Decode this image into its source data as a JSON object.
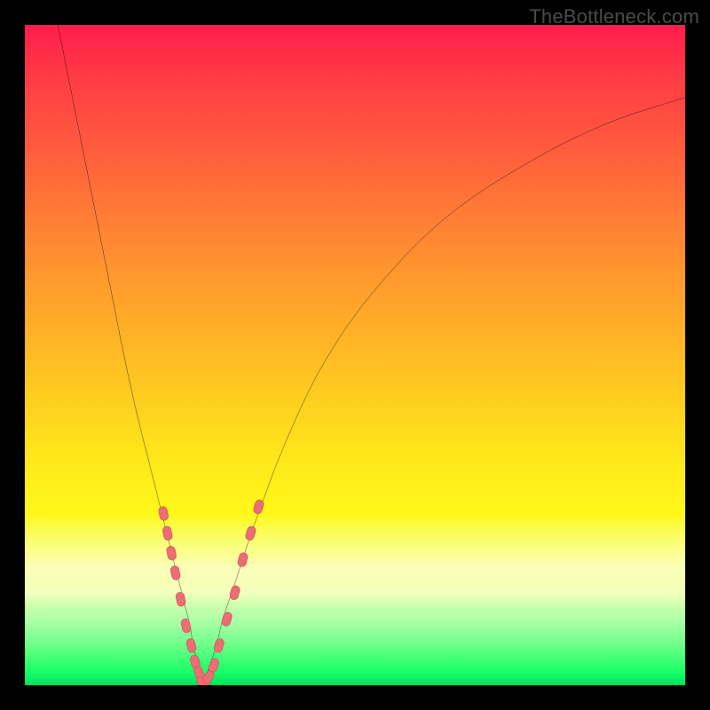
{
  "watermark": "TheBottleneck.com",
  "colors": {
    "frame": "#000000",
    "curve_stroke": "#000000",
    "marker_fill": "#eb6e73",
    "marker_stroke": "#d85c62",
    "gradient_top": "#ff1e4b",
    "gradient_bottom": "#00e060"
  },
  "chart_data": {
    "type": "line",
    "title": "",
    "xlabel": "",
    "ylabel": "",
    "xlim": [
      0,
      100
    ],
    "ylim": [
      0,
      100
    ],
    "note": "Bottleneck-style V curve. y = mismatch (0 at valley). x = relative capability. Values estimated from pixel positions; no axis ticks in source image.",
    "series": [
      {
        "name": "left-branch",
        "x": [
          5,
          7,
          9,
          11,
          13,
          15,
          17,
          19,
          21,
          22,
          23,
          24,
          25,
          25.5,
          26,
          26.5,
          27
        ],
        "y": [
          100,
          90,
          80,
          70,
          60,
          50,
          41,
          33,
          25,
          21,
          17,
          13,
          9,
          6,
          4,
          2,
          0
        ]
      },
      {
        "name": "right-branch",
        "x": [
          27,
          28,
          29,
          30,
          32,
          35,
          40,
          46,
          54,
          64,
          76,
          88,
          100
        ],
        "y": [
          0,
          3,
          6,
          10,
          16,
          25,
          38,
          50,
          61,
          71,
          79,
          85,
          89
        ]
      }
    ],
    "markers": {
      "name": "highlighted-points",
      "style": "pill",
      "points_xy": [
        [
          21.0,
          26
        ],
        [
          21.6,
          23
        ],
        [
          22.2,
          20
        ],
        [
          22.8,
          17
        ],
        [
          23.6,
          13
        ],
        [
          24.4,
          9
        ],
        [
          25.2,
          6
        ],
        [
          25.8,
          3.5
        ],
        [
          26.4,
          1.8
        ],
        [
          27.0,
          0.5
        ],
        [
          27.8,
          1.2
        ],
        [
          28.6,
          3
        ],
        [
          29.4,
          6
        ],
        [
          30.6,
          10
        ],
        [
          31.8,
          14
        ],
        [
          33.0,
          19
        ],
        [
          34.2,
          23
        ],
        [
          35.4,
          27
        ]
      ]
    }
  }
}
